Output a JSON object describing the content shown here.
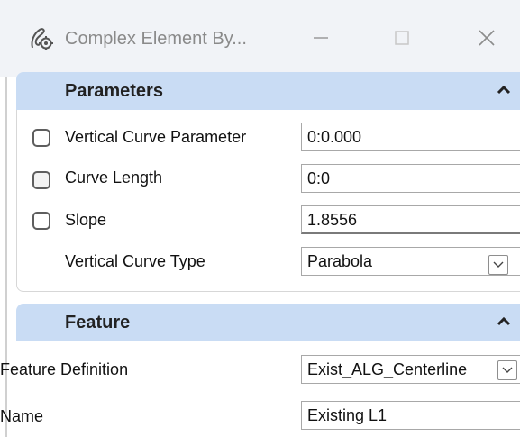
{
  "window": {
    "title": "Complex Element By...",
    "controls": {
      "minimize": "—",
      "close": "✕"
    }
  },
  "parameters": {
    "title": "Parameters",
    "rows": [
      {
        "label": "Vertical Curve Parameter",
        "value": "0:0.000",
        "checked": false
      },
      {
        "label": "Curve Length",
        "value": "0:0",
        "checked": false
      },
      {
        "label": "Slope",
        "value": "1.8556",
        "checked": false
      }
    ],
    "curve_type": {
      "label": "Vertical Curve Type",
      "value": "Parabola"
    }
  },
  "feature": {
    "title": "Feature",
    "definition": {
      "label": "Feature Definition",
      "value": "Exist_ALG_Centerline"
    },
    "name": {
      "label": "Name",
      "value": "Existing L1"
    }
  },
  "colors": {
    "section_header": "#c9dcf4",
    "titlebar": "#f1f3f7"
  },
  "icons": [
    "app-icon",
    "minimize-icon",
    "maximize-icon",
    "close-icon",
    "collapse-caret-icon",
    "dropdown-chevron-icon"
  ]
}
